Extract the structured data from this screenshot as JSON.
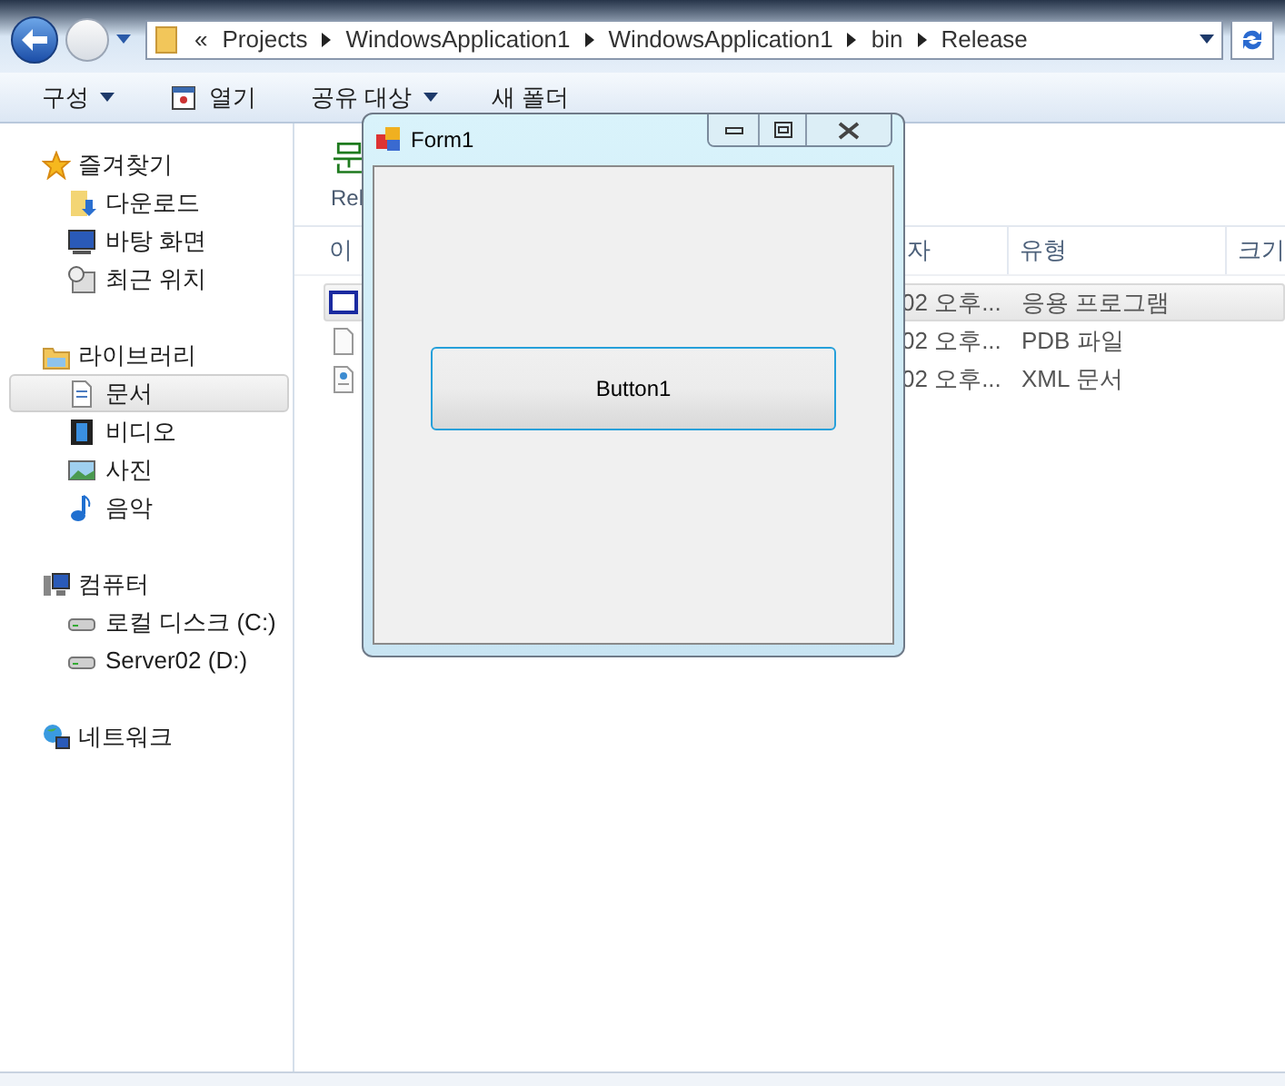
{
  "address_bar": {
    "crumbs": [
      "«",
      "Projects",
      "WindowsApplication1",
      "WindowsApplication1",
      "bin",
      "Release"
    ]
  },
  "toolbar": {
    "items": [
      {
        "label": "구성",
        "kind": "menu"
      },
      {
        "label": "열기",
        "kind": "open"
      },
      {
        "label": "공유 대상",
        "kind": "menu"
      },
      {
        "label": "새 폴더",
        "kind": "plain"
      }
    ]
  },
  "nav": {
    "groups": [
      {
        "label": "즐겨찾기",
        "kind": "star",
        "children": [
          {
            "label": "다운로드",
            "kind": "download",
            "selected": false
          },
          {
            "label": "바탕 화면",
            "kind": "desktop",
            "selected": false
          },
          {
            "label": "최근 위치",
            "kind": "recent",
            "selected": false
          }
        ]
      },
      {
        "label": "라이브러리",
        "kind": "library",
        "children": [
          {
            "label": "문서",
            "kind": "document",
            "selected": true
          },
          {
            "label": "비디오",
            "kind": "video",
            "selected": false
          },
          {
            "label": "사진",
            "kind": "photo",
            "selected": false
          },
          {
            "label": "음악",
            "kind": "music",
            "selected": false
          }
        ]
      },
      {
        "label": "컴퓨터",
        "kind": "computer",
        "children": [
          {
            "label": "로컬 디스크 (C:)",
            "kind": "drive",
            "selected": false
          },
          {
            "label": "Server02 (D:)",
            "kind": "drive",
            "selected": false
          }
        ]
      },
      {
        "label": "네트워크",
        "kind": "network"
      }
    ]
  },
  "content": {
    "heading": "문",
    "subtitle": "Rel",
    "columns": [
      "이",
      "자",
      "유형",
      "크기"
    ],
    "rows": [
      {
        "kind": "app",
        "date": "02 오후...",
        "type": "응용 프로그램",
        "selected": true
      },
      {
        "kind": "file",
        "date": "02 오후...",
        "type": "PDB 파일",
        "selected": false
      },
      {
        "kind": "xml",
        "date": "02 오후...",
        "type": "XML 문서",
        "selected": false
      }
    ]
  },
  "form": {
    "title": "Form1",
    "button": "Button1"
  }
}
